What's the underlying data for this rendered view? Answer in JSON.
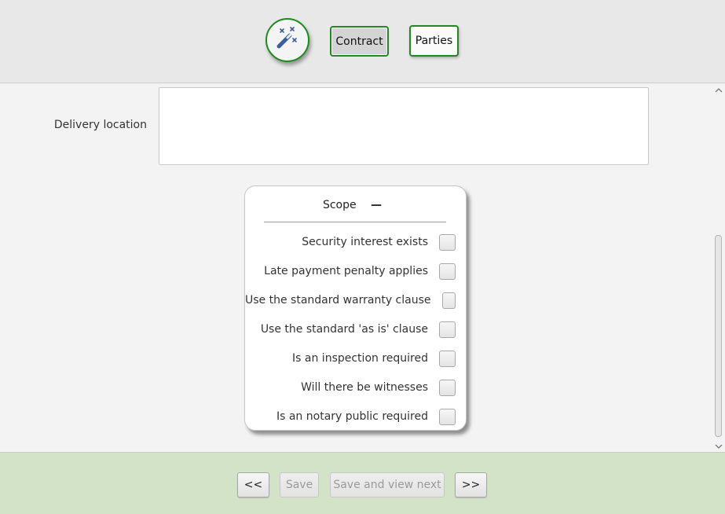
{
  "toolbar": {
    "wizard_icon": "magic-wand-icon",
    "contract_label": "Contract",
    "parties_label": "Parties",
    "accent_color": "#1f8a1f"
  },
  "form": {
    "delivery_location_label": "Delivery location",
    "delivery_location_value": ""
  },
  "scope": {
    "title": "Scope",
    "collapse_symbol": "—",
    "items": [
      {
        "label": "Security interest exists",
        "checked": false
      },
      {
        "label": "Late payment penalty applies",
        "checked": false
      },
      {
        "label": "Use the standard warranty clause",
        "checked": false
      },
      {
        "label": "Use the standard 'as is' clause",
        "checked": false
      },
      {
        "label": "Is an inspection required",
        "checked": false
      },
      {
        "label": "Will there be witnesses",
        "checked": false
      },
      {
        "label": "Is an notary public required",
        "checked": false
      }
    ]
  },
  "footer": {
    "prev_label": "<<",
    "save_label": "Save",
    "save_next_label": "Save and view next",
    "next_label": ">>",
    "background": "#d3e3c7"
  },
  "scrollbar": {
    "up_arrow": "⌃",
    "down_arrow": "⌄"
  }
}
